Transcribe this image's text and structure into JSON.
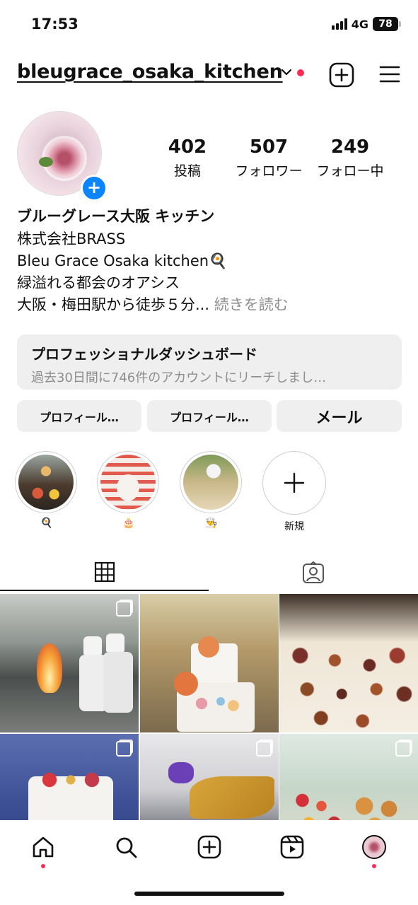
{
  "status_bar": {
    "time": "17:53",
    "network": "4G",
    "battery": "78"
  },
  "header": {
    "username": "bleugrace_osaka_kitchen"
  },
  "stats": [
    {
      "value": "402",
      "label": "投稿"
    },
    {
      "value": "507",
      "label": "フォロワー"
    },
    {
      "value": "249",
      "label": "フォロー中"
    }
  ],
  "bio": {
    "name": "ブルーグレース大阪 キッチン",
    "line1": "株式会社BRASS",
    "line2": "Bleu Grace Osaka kitchen🍳",
    "line3": "緑溢れる都会のオアシス",
    "line4": "大阪・梅田駅から徒歩５分...",
    "more": "続きを読む"
  },
  "dashboard": {
    "title": "プロフェッショナルダッシュボード",
    "subtitle": "過去30日間に746件のアカウントにリーチしまし…"
  },
  "buttons": {
    "edit_profile": "プロフィール…",
    "share_profile": "プロフィール…",
    "mail": "メール"
  },
  "highlights": [
    {
      "caption": "🍳"
    },
    {
      "caption": "🎂"
    },
    {
      "caption": "👨‍🍳"
    },
    {
      "caption": "新規"
    }
  ],
  "colors": {
    "accent_blue": "#0a84ff",
    "notification_red": "#ff2d55",
    "button_bg": "#efefef",
    "muted_text": "#8e8e8e"
  }
}
